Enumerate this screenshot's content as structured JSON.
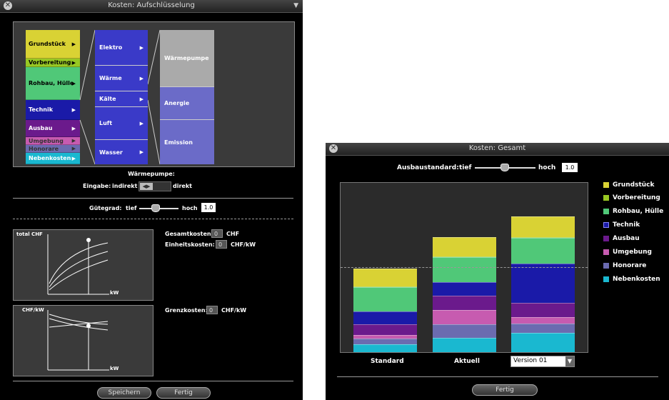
{
  "window1": {
    "title": "Kosten: Aufschlüsselung",
    "cost_categories": [
      {
        "label": "Grundstück",
        "color": "#d9d234"
      },
      {
        "label": "Vorbereitung",
        "color": "#98c823"
      },
      {
        "label": "Rohbau, Hülle",
        "color": "#50c878"
      },
      {
        "label": "Technik",
        "color": "#1a1aa8"
      },
      {
        "label": "Ausbau",
        "color": "#6b1a8c"
      },
      {
        "label": "Umgebung",
        "color": "#c75bb0"
      },
      {
        "label": "Honorare",
        "color": "#6b6bb0"
      },
      {
        "label": "Nebenkosten",
        "color": "#1ab8d0"
      }
    ],
    "technik_items": [
      {
        "label": "Elektro"
      },
      {
        "label": "Wärme"
      },
      {
        "label": "Kälte"
      },
      {
        "label": "Luft"
      },
      {
        "label": "Wasser"
      }
    ],
    "waerme_items": [
      {
        "label": "Wärmepumpe",
        "color": "#aaaaaa"
      },
      {
        "label": "Anergie",
        "color": "#6b6bc8"
      },
      {
        "label": "Emission",
        "color": "#6b6bc8"
      }
    ],
    "selected_title": "Wärmepumpe:",
    "eingabe_label": "Eingabe:",
    "indirekt_label": "indirekt",
    "direkt_label": "direkt",
    "guetegrad_label": "Gütegrad:",
    "tief_label": "tief",
    "hoch_label": "hoch",
    "guetegrad_value": "1.0",
    "chart1_ylabel": "total CHF",
    "chart1_xlabel": "kW",
    "chart2_ylabel": "CHF/kW",
    "chart2_xlabel": "kW",
    "gesamtkosten_label": "Gesamtkosten:",
    "gesamtkosten_value": "0",
    "gesamtkosten_unit": "CHF",
    "einheitskosten_label": "Einheitskosten:",
    "einheitskosten_value": "0",
    "einheitskosten_unit": "CHF/kW",
    "grenzkosten_label": "Grenzkosten:",
    "grenzkosten_value": "0",
    "grenzkosten_unit": "CHF/kW",
    "speichern_label": "Speichern",
    "fertig_label": "Fertig"
  },
  "window2": {
    "title": "Kosten: Gesamt",
    "ausbaustandard_label": "Ausbaustandard:",
    "tief_label": "tief",
    "hoch_label": "hoch",
    "ausbaustandard_value": "1.0",
    "standard_label": "Standard",
    "aktuell_label": "Aktuell",
    "version_value": "Version 01",
    "fertig_label": "Fertig"
  },
  "chart_data": {
    "type": "bar",
    "stacked": true,
    "categories": [
      "Standard",
      "Aktuell",
      "Version 01"
    ],
    "series": [
      {
        "name": "Nebenkosten",
        "color": "#1ab8d0",
        "values": [
          0.045,
          0.085,
          0.115
        ]
      },
      {
        "name": "Honorare",
        "color": "#6b6bb0",
        "values": [
          0.035,
          0.08,
          0.055
        ]
      },
      {
        "name": "Umgebung",
        "color": "#c75bb0",
        "values": [
          0.02,
          0.085,
          0.035
        ]
      },
      {
        "name": "Ausbau",
        "color": "#6b1a8c",
        "values": [
          0.065,
          0.085,
          0.085
        ]
      },
      {
        "name": "Technik",
        "color": "#1a1aa8",
        "values": [
          0.075,
          0.08,
          0.235
        ]
      },
      {
        "name": "Rohbau, Hülle",
        "color": "#50c878",
        "values": [
          0.145,
          0.145,
          0.15
        ]
      },
      {
        "name": "Vorbereitung",
        "color": "#98c823",
        "values": [
          0.005,
          0.005,
          0.005
        ]
      },
      {
        "name": "Grundstück",
        "color": "#d9d234",
        "values": [
          0.105,
          0.115,
          0.12
        ]
      }
    ],
    "reference_line": 0.5,
    "legend_position": "right",
    "grid": false
  }
}
